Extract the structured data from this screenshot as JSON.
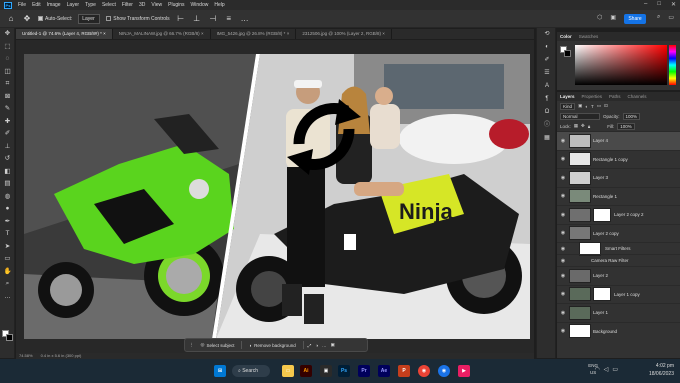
{
  "menu": {
    "items": [
      "File",
      "Edit",
      "Image",
      "Layer",
      "Type",
      "Select",
      "Filter",
      "3D",
      "View",
      "Plugins",
      "Window",
      "Help"
    ]
  },
  "options": {
    "auto_select_label": "Auto-Select:",
    "auto_select_target": "Layer",
    "show_transform_label": "Show Transform Controls",
    "share_label": "Share"
  },
  "tabs": [
    {
      "label": "Untitled-1 @ 74.6% (Layer 4, RGB/8#) *",
      "active": true
    },
    {
      "label": "NINJA_MALINAW.jpg @ 66.7% (RGB/8)",
      "active": false
    },
    {
      "label": "IMG_5426.jpg @ 26.8% (RGB/8) *",
      "active": false
    },
    {
      "label": "2312506.jpg @ 100% (Layer 2, RGB/8)",
      "active": false
    }
  ],
  "color_panel": {
    "tabs": [
      "Color",
      "Swatches"
    ]
  },
  "layers_panel": {
    "tabs": [
      "Layers",
      "Properties",
      "Paths",
      "Channels"
    ],
    "kind_label": "Kind",
    "blend_mode": "Normal",
    "opacity_label": "Opacity:",
    "opacity_value": "100%",
    "lock_label": "Lock:",
    "fill_label": "Fill:",
    "fill_value": "100%",
    "layers": [
      {
        "name": "Layer 4",
        "selected": true,
        "mask": false,
        "sub": false,
        "thumb": "#bdbdbd"
      },
      {
        "name": "Rectangle 1 copy",
        "selected": false,
        "mask": false,
        "sub": false,
        "thumb": "#e6e6e6"
      },
      {
        "name": "Layer 3",
        "selected": false,
        "mask": false,
        "sub": false,
        "thumb": "#cfcfcf"
      },
      {
        "name": "Rectangle 1",
        "selected": false,
        "mask": false,
        "sub": false,
        "thumb": "#7a8a7a"
      },
      {
        "name": "Layer 2 copy 2",
        "selected": false,
        "mask": true,
        "sub": false,
        "thumb": "#6f6f6f"
      },
      {
        "name": "Layer 2 copy",
        "selected": false,
        "mask": false,
        "sub": false,
        "thumb": "#777777"
      },
      {
        "name": "Smart Filters",
        "selected": false,
        "mask": true,
        "sub": true,
        "thumb": "#ffffff"
      },
      {
        "name": "Camera Raw Filter",
        "selected": false,
        "mask": false,
        "sub": true,
        "thumb": ""
      },
      {
        "name": "Layer 2",
        "selected": false,
        "mask": false,
        "sub": false,
        "thumb": "#6a6a6a"
      },
      {
        "name": "Layer 1 copy",
        "selected": false,
        "mask": true,
        "sub": false,
        "thumb": "#5a6a5a"
      },
      {
        "name": "Layer 1",
        "selected": false,
        "mask": false,
        "sub": false,
        "thumb": "#5a6a5a"
      },
      {
        "name": "Background",
        "selected": false,
        "mask": false,
        "sub": false,
        "thumb": "#ffffff"
      }
    ]
  },
  "status": {
    "zoom": "74.58%",
    "doc_info": "0.4 in x 5.6 in (300 ppi)"
  },
  "context_bar": {
    "select_subject": "Select subject",
    "remove_background": "Remove background"
  },
  "taskbar": {
    "search": "Search",
    "lang_top": "ENG",
    "lang_bottom": "US",
    "time": "4:02 pm",
    "date": "18/06/2023"
  },
  "canvas_art": {
    "left_bike_text": "",
    "right_bike_text": "Ninja"
  }
}
